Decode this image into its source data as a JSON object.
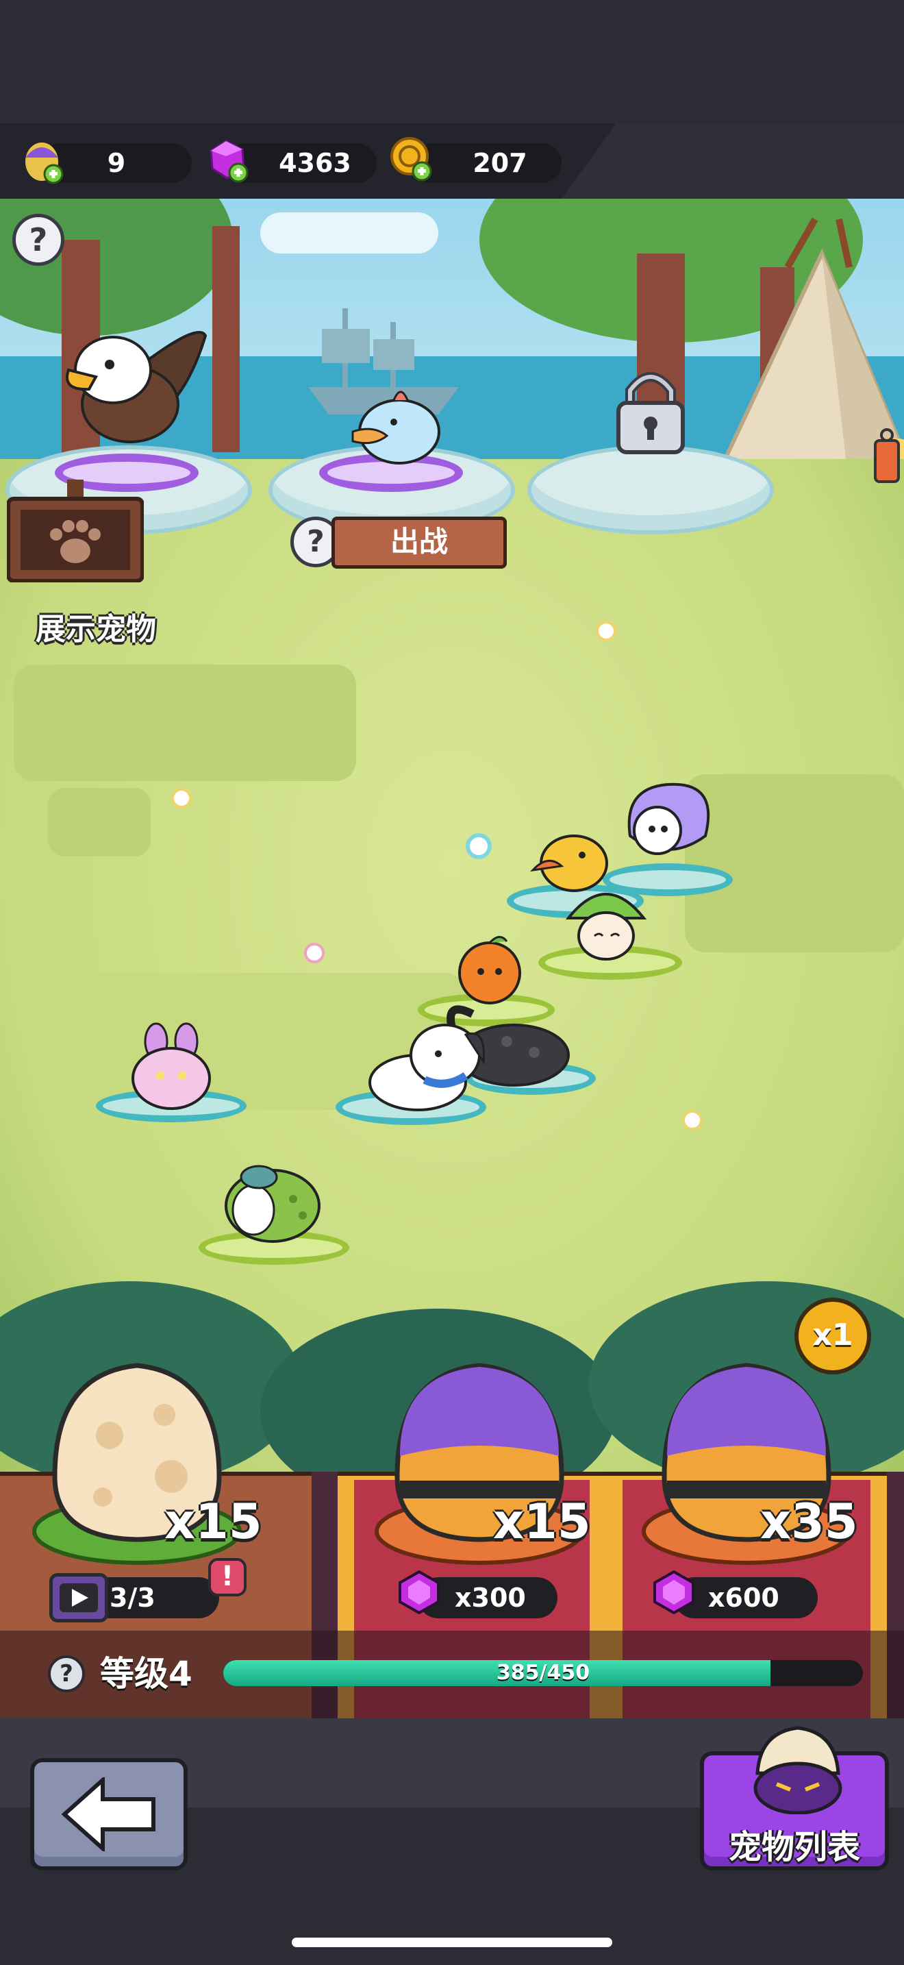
{
  "resources": {
    "egg_tickets": "9",
    "gems": "4363",
    "gold": "207"
  },
  "scene": {
    "showcase_label": "展示宠物",
    "deploy_label": "出战"
  },
  "eggs": [
    {
      "count": "x15",
      "cost_kind": "video",
      "cost": "3/3"
    },
    {
      "count": "x15",
      "cost_kind": "gem",
      "cost": "x300"
    },
    {
      "count": "x35",
      "cost_kind": "gem",
      "cost": "x600"
    }
  ],
  "multiplier": "x1",
  "level": {
    "label": "等级4",
    "xp_text": "385/450",
    "progress": 0.855
  },
  "nav": {
    "pet_list_label": "宠物列表"
  },
  "colors": {
    "gem": "#c32ee0",
    "gold": "#f1b21d",
    "xp": "#2ccf9c",
    "accent_card": "#f2b33a"
  }
}
